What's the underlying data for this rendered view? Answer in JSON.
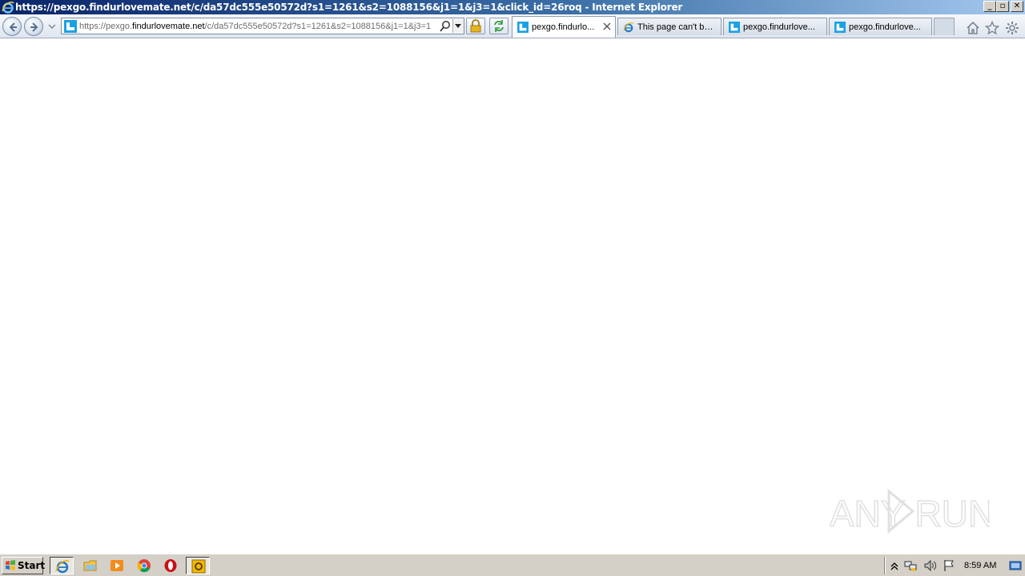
{
  "window": {
    "title": "https://pexgo.findurlovemate.net/c/da57dc555e50572d?s1=1261&s2=1088156&j1=1&j3=1&click_id=26roq - Internet Explorer",
    "controls": {
      "minimize": "_",
      "restore": "▫",
      "close": "✕"
    }
  },
  "address_bar": {
    "url_prefix": "https://pexgo.",
    "url_domain": "findurlovemate.net",
    "url_rest": "/c/da57dc555e50572d?s1=1261&s2=1088156&j1=1&j3=1"
  },
  "tabs": [
    {
      "label": "pexgo.findurlo...",
      "active": true,
      "icon": "site-favicon"
    },
    {
      "label": "This page can't be...",
      "active": false,
      "icon": "ie-icon"
    },
    {
      "label": "pexgo.findurlove...",
      "active": false,
      "icon": "site-favicon"
    },
    {
      "label": "pexgo.findurlove...",
      "active": false,
      "icon": "site-favicon"
    }
  ],
  "toolbar_icons": [
    "home-icon",
    "favorites-star-icon",
    "tools-gear-icon"
  ],
  "watermark": {
    "text": "ANY RUN"
  },
  "taskbar": {
    "start_label": "Start",
    "apps": [
      "ie-icon",
      "explorer-folder-icon",
      "media-player-icon",
      "chrome-icon",
      "opera-icon",
      "outlook-icon"
    ],
    "clock": "8:59 AM"
  },
  "colors": {
    "titlebar_start": "#0a246a",
    "titlebar_end": "#a6caf0",
    "site_favicon": "#1ba1e2",
    "taskbar": "#d4d0c8"
  }
}
